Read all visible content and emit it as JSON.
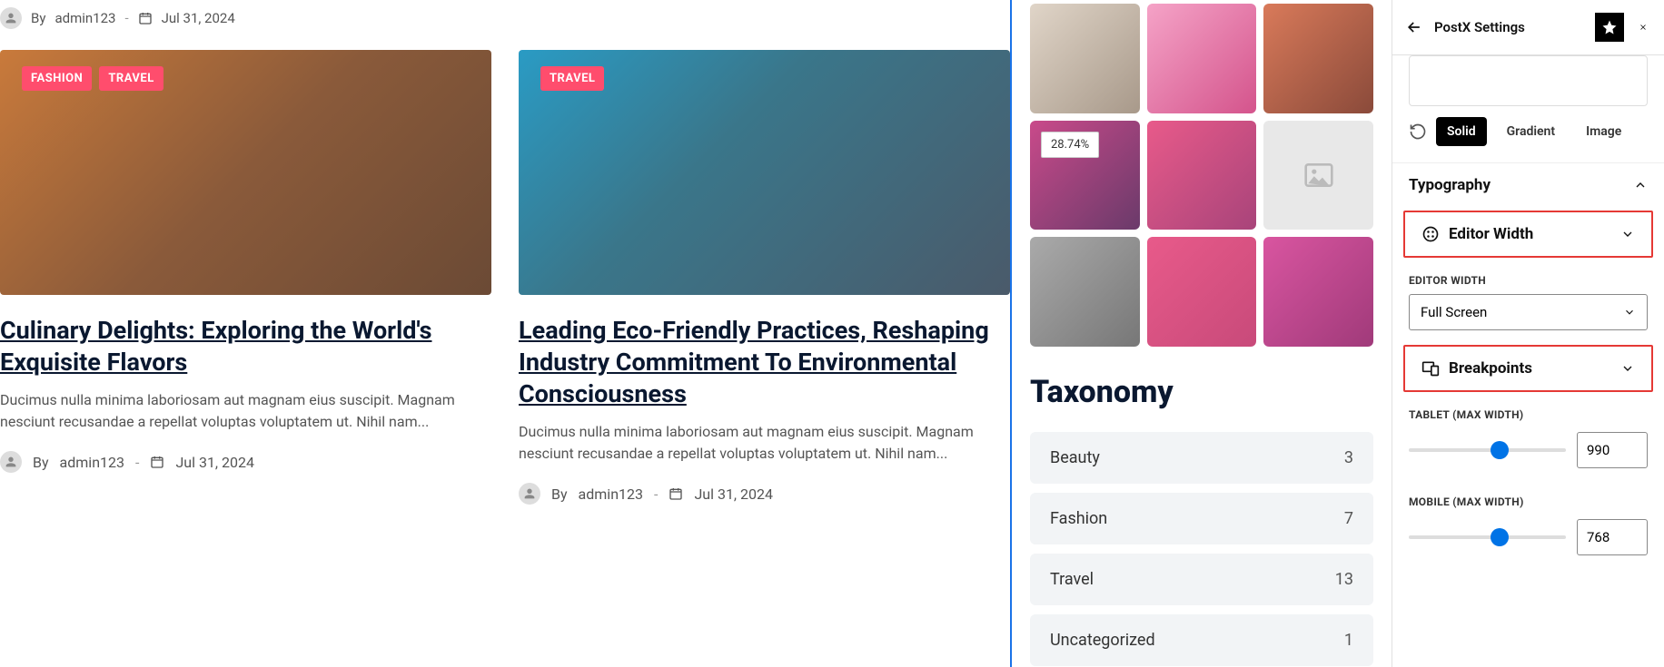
{
  "top_meta": {
    "by": "By",
    "author": "admin123",
    "date": "Jul 31, 2024"
  },
  "posts": [
    {
      "tags": [
        "FASHION",
        "TRAVEL"
      ],
      "title": "Culinary Delights: Exploring the World's Exquisite Flavors",
      "excerpt": "Ducimus nulla minima laboriosam aut magnam eius suscipit. Magnam nesciunt recusandae a repellat voluptas voluptatem ut. Nihil nam...",
      "by": "By",
      "author": "admin123",
      "date": "Jul 31, 2024"
    },
    {
      "tags": [
        "TRAVEL"
      ],
      "title": "Leading Eco-Friendly Practices, Reshaping Industry Commitment To Environmental Consciousness",
      "excerpt": "Ducimus nulla minima laboriosam aut magnam eius suscipit. Magnam nesciunt recusandae a repellat voluptas voluptatem ut. Nihil nam...",
      "by": "By",
      "author": "admin123",
      "date": "Jul 31, 2024"
    }
  ],
  "grid": {
    "percent_badge": "28.74%"
  },
  "taxonomy": {
    "heading": "Taxonomy",
    "items": [
      {
        "label": "Beauty",
        "count": "3"
      },
      {
        "label": "Fashion",
        "count": "7"
      },
      {
        "label": "Travel",
        "count": "13"
      },
      {
        "label": "Uncategorized",
        "count": "1"
      }
    ]
  },
  "sidebar": {
    "title": "PostX Settings",
    "fill": {
      "solid": "Solid",
      "gradient": "Gradient",
      "image": "Image"
    },
    "panels": {
      "typography": "Typography",
      "editor_width": "Editor Width",
      "breakpoints": "Breakpoints"
    },
    "editor_width_label": "EDITOR WIDTH",
    "editor_width_value": "Full Screen",
    "tablet_label": "TABLET (MAX WIDTH)",
    "tablet_value": "990",
    "mobile_label": "MOBILE (MAX WIDTH)",
    "mobile_value": "768"
  }
}
